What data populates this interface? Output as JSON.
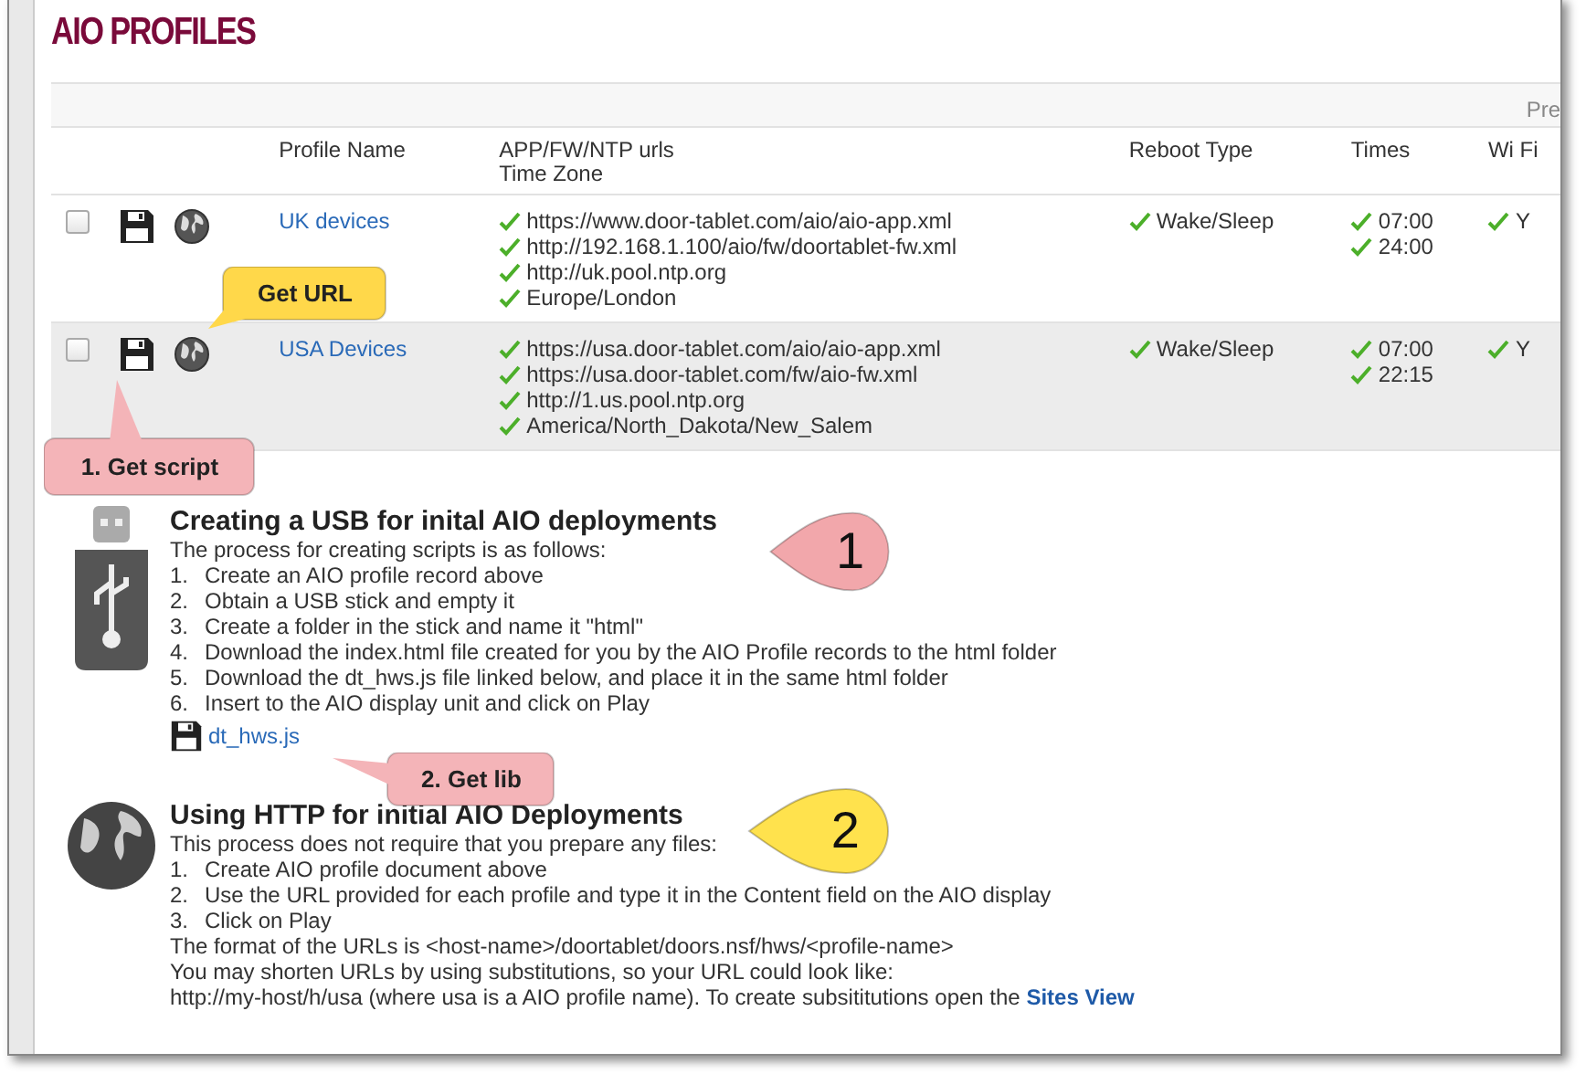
{
  "title": "AIO PROFILES",
  "toolbar": {
    "text": "Pre"
  },
  "columns": [
    {
      "lines": [
        "Profile Name"
      ]
    },
    {
      "lines": [
        "APP/FW/NTP urls",
        "Time Zone"
      ]
    },
    {
      "lines": [
        "Reboot Type"
      ]
    },
    {
      "lines": [
        "Times"
      ]
    },
    {
      "lines": [
        "Wi Fi"
      ]
    }
  ],
  "rows": [
    {
      "checked": false,
      "highlighted": false,
      "name": "UK devices",
      "urls": [
        "https://www.door-tablet.com/aio/aio-app.xml",
        "http://192.168.1.100/aio/fw/doortablet-fw.xml",
        "http://uk.pool.ntp.org",
        "Europe/London"
      ],
      "reboot": "Wake/Sleep",
      "times": [
        "07:00",
        "24:00"
      ],
      "wifi": "Y"
    },
    {
      "checked": false,
      "highlighted": true,
      "name": "USA Devices",
      "urls": [
        "https://usa.door-tablet.com/aio/aio-app.xml",
        "https://usa.door-tablet.com/fw/aio-fw.xml",
        "http://1.us.pool.ntp.org",
        "America/North_Dakota/New_Salem"
      ],
      "reboot": "Wake/Sleep",
      "times": [
        "07:00",
        "22:15"
      ],
      "wifi": "Y"
    }
  ],
  "sections": [
    {
      "kind": "usb",
      "heading": "Creating a USB for inital AIO deployments",
      "intro": "The process for creating scripts is as follows:",
      "steps": [
        {
          "num": "1.",
          "text": "Create an AIO profile record above"
        },
        {
          "num": "2.",
          "text": "Obtain a USB stick and empty it"
        },
        {
          "num": "3.",
          "text": "Create a folder in the stick and name it \"html\""
        },
        {
          "num": "4.",
          "text": "Download the index.html file created for you by the AIO Profile records to the html folder"
        },
        {
          "num": "5.",
          "text": "Download the dt_hws.js file linked below, and place it in the same html folder"
        },
        {
          "num": "6.",
          "text": "Insert to the AIO display unit and click on Play"
        }
      ],
      "file_link": "dt_hws.js"
    },
    {
      "kind": "globe",
      "heading": "Using HTTP for initial AIO Deployments",
      "intro": "This process does not require that you prepare any files:",
      "steps": [
        {
          "num": "1.",
          "text": "Create AIO profile document above"
        },
        {
          "num": "2.",
          "text": "Use the URL provided for each profile and type it in the Content field on the AIO display"
        },
        {
          "num": "3.",
          "text": "Click on Play"
        }
      ],
      "notes": [
        "The format of the URLs is <host-name>/doortablet/doors.nsf/hws/<profile-name>",
        "You may shorten URLs by using substitutions, so your URL could look like:"
      ],
      "last_line": {
        "text": "http://my-host/h/usa (where usa is a AIO profile name).  To create subsititutions open the",
        "link": "Sites View"
      }
    }
  ],
  "callouts": [
    {
      "kind": "rect",
      "text": "Get URL",
      "color": "#ffd84a"
    },
    {
      "kind": "rect",
      "text": "1. Get script",
      "color": "#f4b4b8"
    },
    {
      "kind": "drop",
      "text": "1",
      "color": "#f2a7ab"
    },
    {
      "kind": "rect",
      "text": "2. Get lib",
      "color": "#f4b4b8"
    },
    {
      "kind": "drop",
      "text": "2",
      "color": "#ffe24d"
    }
  ]
}
